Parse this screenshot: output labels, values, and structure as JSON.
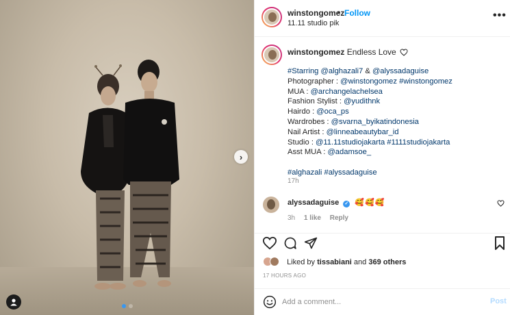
{
  "header": {
    "username": "winstongomez",
    "separator": "•",
    "follow_label": "Follow",
    "location": "11.11 studio pik",
    "more_label": "•••"
  },
  "caption": {
    "username": "winstongomez",
    "text": "Endless Love",
    "lines": [
      [
        {
          "t": "#Starring @alghazali7",
          "blue": true
        },
        {
          "t": " & ",
          "blue": false
        },
        {
          "t": "@alyssadaguise",
          "blue": true
        }
      ],
      [
        {
          "t": "Photographer : ",
          "blue": false
        },
        {
          "t": "@winstongomez #winstongomez",
          "blue": true
        }
      ],
      [
        {
          "t": "MUA : ",
          "blue": false
        },
        {
          "t": "@archangelachelsea",
          "blue": true
        }
      ],
      [
        {
          "t": "Fashion Stylist : ",
          "blue": false
        },
        {
          "t": "@yudithnk",
          "blue": true
        }
      ],
      [
        {
          "t": "Hairdo : ",
          "blue": false
        },
        {
          "t": "@oca_ps",
          "blue": true
        }
      ],
      [
        {
          "t": "Wardrobes : ",
          "blue": false
        },
        {
          "t": "@svarna_byikatindonesia",
          "blue": true
        }
      ],
      [
        {
          "t": "Nail Artist : ",
          "blue": false
        },
        {
          "t": "@linneabeautybar_id",
          "blue": true
        }
      ],
      [
        {
          "t": "Studio : ",
          "blue": false
        },
        {
          "t": "@11.11studiojakarta #1111studiojakarta",
          "blue": true
        }
      ],
      [
        {
          "t": "Asst MUA : ",
          "blue": false
        },
        {
          "t": "@adamsoe_",
          "blue": true
        }
      ],
      [
        {
          "t": "",
          "blue": false
        }
      ],
      [
        {
          "t": "#alghazali #alyssadaguise",
          "blue": true
        }
      ]
    ],
    "time": "17h"
  },
  "comment": {
    "username": "alyssadaguise",
    "verified_mark": "✓",
    "emojis": "🥰🥰🥰",
    "time": "3h",
    "likes": "1 like",
    "reply": "Reply"
  },
  "likes": {
    "prefix": "Liked by",
    "user": "tissabiani",
    "middle": "and",
    "others": "369 others"
  },
  "timestamp": "17 HOURS AGO",
  "add_comment": {
    "placeholder": "Add a comment...",
    "post_label": "Post"
  },
  "carousel": {
    "slides": 2,
    "active_index": 0,
    "next_label": "›"
  },
  "colors": {
    "link_blue": "#00376b",
    "follow_blue": "#0095f6",
    "post_disabled": "#b3dbff",
    "muted": "#8e8e8e"
  }
}
